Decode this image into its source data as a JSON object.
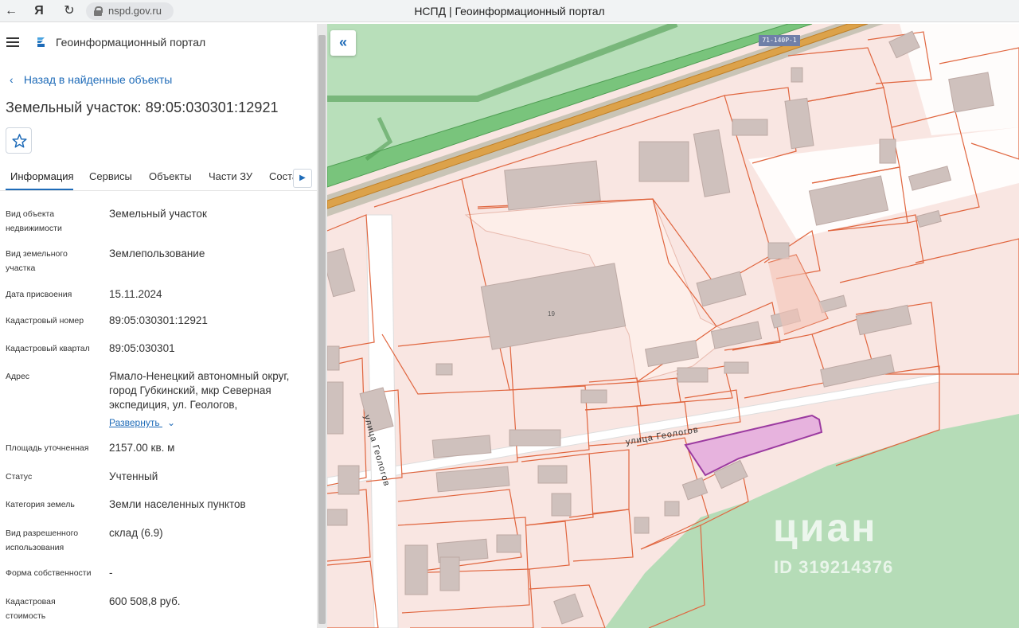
{
  "browser": {
    "url": "nspd.gov.ru",
    "tab_title": "НСПД | Геоинформационный портал",
    "back_glyph": "←",
    "yandex_glyph": "Я",
    "reload_glyph": "↻"
  },
  "app": {
    "title": "Геоинформационный портал",
    "back_label": "Назад в найденные объекты",
    "object_title": "Земельный участок: 89:05:030301:12921"
  },
  "tabs": [
    {
      "label": "Информация",
      "active": true
    },
    {
      "label": "Сервисы"
    },
    {
      "label": "Объекты"
    },
    {
      "label": "Части ЗУ"
    },
    {
      "label": "Соста"
    }
  ],
  "info": {
    "type": {
      "label": "Вид объекта недвижимости",
      "value": "Земельный участок"
    },
    "land_kind": {
      "label": "Вид земельного участка",
      "value": "Землепользование"
    },
    "date": {
      "label": "Дата присвоения",
      "value": "15.11.2024"
    },
    "cad_num": {
      "label": "Кадастровый номер",
      "value": "89:05:030301:12921"
    },
    "cad_quarter": {
      "label": "Кадастровый квартал",
      "value": "89:05:030301"
    },
    "address": {
      "label": "Адрес",
      "value": "Ямало-Ненецкий автономный округ, город Губкинский, мкр Северная экспедиция, ул. Геологов,",
      "expand": "Развернуть"
    },
    "area": {
      "label": "Площадь уточненная",
      "value": "2157.00 кв. м"
    },
    "status": {
      "label": "Статус",
      "value": "Учтенный"
    },
    "category": {
      "label": "Категория земель",
      "value": "Земли населенных пунктов"
    },
    "use": {
      "label": "Вид разрешенного использования",
      "value": "склад (6.9)"
    },
    "ownership": {
      "label": "Форма собственности",
      "value": "-"
    },
    "cad_value": {
      "label": "Кадастровая стоимость",
      "value": "600 508,8 руб."
    }
  },
  "map": {
    "road_badge": "71-140Р-1",
    "parcel_number": "19",
    "street_label_1": "улица  Геологов",
    "street_label_2": "улица  Геологов",
    "watermark": "циан",
    "watermark_id": "ID 319214376",
    "colors": {
      "parcel_fill": "#f7d9d3",
      "parcel_border": "#e0653e",
      "building": "#c9b8b4",
      "road_orange": "#dca24a",
      "green_strip": "#75bf78",
      "green_area": "#b5dcb7",
      "selected": "#e7b3de"
    }
  }
}
